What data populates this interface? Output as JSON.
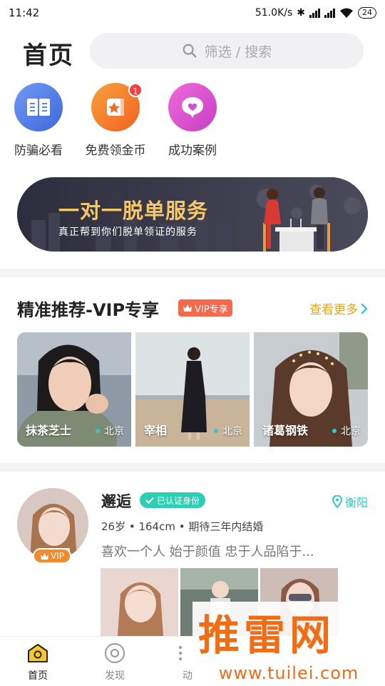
{
  "status_bar": {
    "time": "11:42",
    "speed": "51.0K/s",
    "battery": "24"
  },
  "header": {
    "title": "首页",
    "search_placeholder": "筛选 / 搜索"
  },
  "quick_actions": [
    {
      "label": "防骗必看",
      "icon": "book-icon",
      "color": "#4d7de8"
    },
    {
      "label": "免费领金币",
      "icon": "gift-star-icon",
      "color": "#f4782b",
      "badge": "1"
    },
    {
      "label": "成功案例",
      "icon": "heart-chat-icon",
      "color": "#d94ec9"
    }
  ],
  "banner": {
    "title": "一对一脱单服务",
    "subtitle": "真正帮到你们脱单领证的服务"
  },
  "vip_section": {
    "title": "精准推荐-VIP专享",
    "tag": "VIP专享",
    "more": "查看更多",
    "cards": [
      {
        "name": "抹茶芝士",
        "city": "北京"
      },
      {
        "name": "宰相",
        "city": "北京"
      },
      {
        "name": "诸葛钢铁",
        "city": "北京"
      }
    ]
  },
  "profile": {
    "name": "邂逅",
    "verified": "已认证身份",
    "location": "衡阳",
    "vip": "VIP",
    "info": "26岁 • 164cm • 期待三年内结婚",
    "bio": "喜欢一个人 始于颜值 忠于人品陷于..."
  },
  "nav": [
    {
      "label": "首页",
      "icon": "home-icon",
      "active": true
    },
    {
      "label": "发现",
      "icon": "discover-icon"
    },
    {
      "label": "动",
      "icon": "feed-icon"
    }
  ],
  "watermark": {
    "text": "推雷网",
    "url": "www.tuilei.com"
  },
  "colors": {
    "accent": "#e7a51b",
    "teal": "#2ccfb5",
    "vip": "#f46a4c"
  }
}
